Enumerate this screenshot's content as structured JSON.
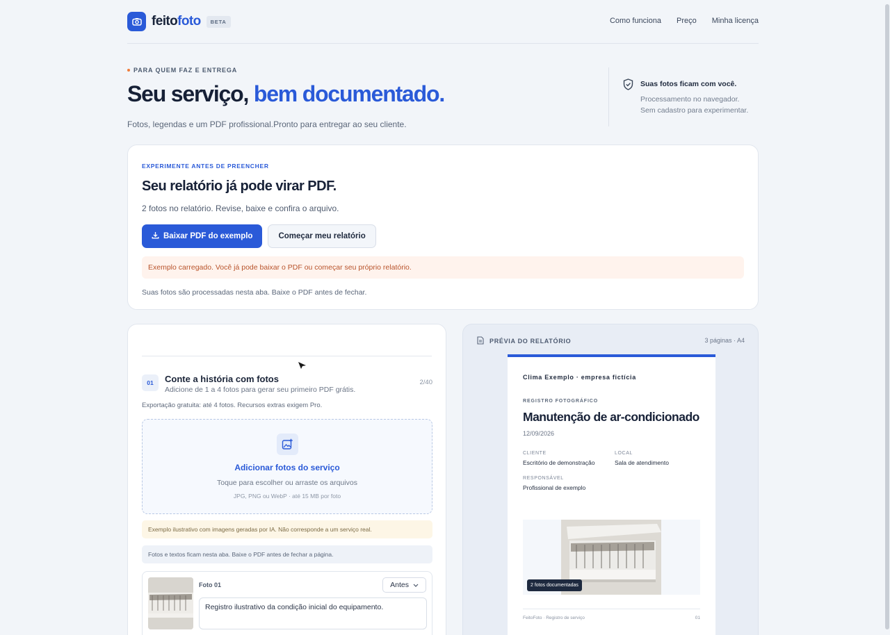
{
  "brand": {
    "name_a": "feito",
    "name_b": "foto",
    "beta": "BETA"
  },
  "nav": [
    "Como funciona",
    "Preço",
    "Minha licença"
  ],
  "hero": {
    "eyebrow": "PARA QUEM FAZ E ENTREGA",
    "title_a": "Seu serviço, ",
    "title_b": "bem documentado.",
    "subtitle": "Fotos, legendas e um PDF profissional.Pronto para entregar ao seu cliente."
  },
  "privacy": {
    "title": "Suas fotos ficam com você.",
    "line1": "Processamento no navegador.",
    "line2": "Sem cadastro para experimentar."
  },
  "example": {
    "eyebrow": "EXPERIMENTE ANTES DE PREENCHER",
    "title": "Seu relatório já pode virar PDF.",
    "subtitle": "2 fotos no relatório. Revise, baixe e confira o arquivo.",
    "download_label": "Baixar PDF do exemplo",
    "start_label": "Começar meu relatório",
    "alert": "Exemplo carregado. Você já pode baixar o PDF ou começar seu próprio relatório.",
    "note": "Suas fotos são processadas nesta aba. Baixe o PDF antes de fechar."
  },
  "editor": {
    "step_num": "01",
    "step_title": "Conte a história com fotos",
    "step_desc": "Adicione de 1 a 4 fotos para gerar seu primeiro PDF grátis.",
    "count": "2/40",
    "export_note": "Exportação gratuita: até 4 fotos. Recursos extras exigem Pro.",
    "drop_title": "Adicionar fotos do serviço",
    "drop_sub": "Toque para escolher ou arraste os arquivos",
    "drop_formats": "JPG, PNG ou WebP · até 15 MB por foto",
    "warning": "Exemplo ilustrativo com imagens geradas por IA. Não corresponde a um serviço real.",
    "info": "Fotos e textos ficam nesta aba. Baixe o PDF antes de fechar a página.",
    "photo": {
      "label": "Foto 01",
      "stage": "Antes",
      "caption": "Registro ilustrativo da condição inicial do equipamento."
    }
  },
  "preview": {
    "title": "PRÉVIA DO RELATÓRIO",
    "pages": "3 páginas · A4",
    "company": "Clima Exemplo · empresa fictícia",
    "report_type": "REGISTRO FOTOGRÁFICO",
    "report_title": "Manutenção de ar-condicionado",
    "date": "12/09/2026",
    "client_label": "CLIENTE",
    "client_value": "Escritório de demonstração",
    "local_label": "LOCAL",
    "local_value": "Sala de atendimento",
    "resp_label": "RESPONSÁVEL",
    "resp_value": "Profissional de exemplo",
    "badge": "2 fotos documentadas",
    "footer_left": "FeitoFoto · Registro de serviço",
    "footer_right": "01"
  },
  "colors": {
    "accent": "#2a5ad8",
    "alert_bg": "#fff3ed",
    "alert_text": "#b8532b",
    "warn_bg": "#fdf6e6"
  }
}
